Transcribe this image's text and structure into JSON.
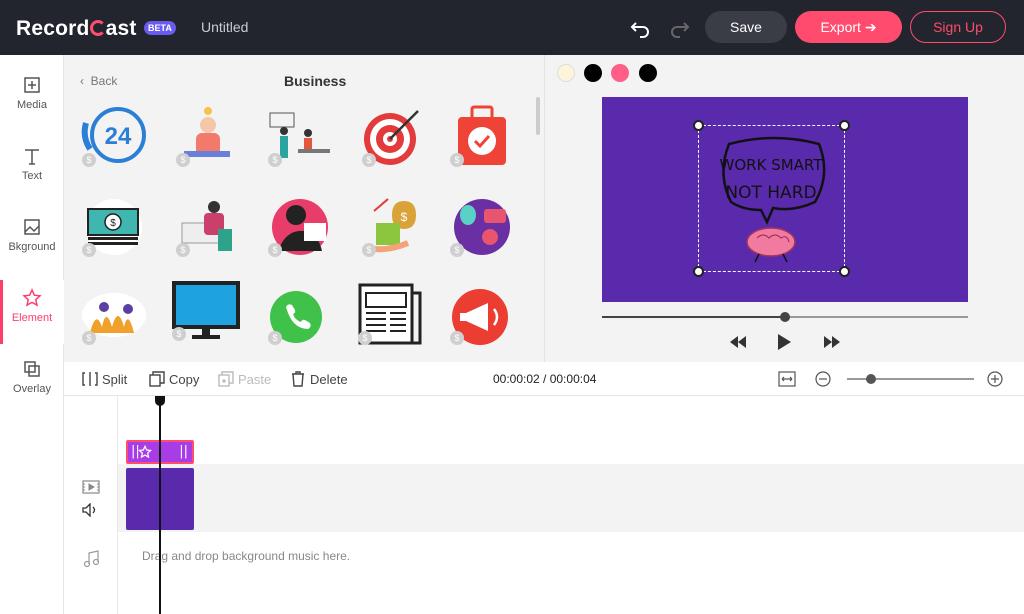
{
  "header": {
    "logo": "Recordcast",
    "beta": "BETA",
    "title": "Untitled",
    "save": "Save",
    "export": "Export",
    "signup": "Sign Up",
    "accent": "#ff4b6e"
  },
  "sidebar": {
    "items": [
      {
        "label": "Media",
        "icon": "media-icon"
      },
      {
        "label": "Text",
        "icon": "text-icon"
      },
      {
        "label": "Bkground",
        "icon": "background-icon"
      },
      {
        "label": "Element",
        "icon": "star-icon",
        "active": true
      },
      {
        "label": "Overlay",
        "icon": "overlay-icon"
      }
    ]
  },
  "panel": {
    "back": "Back",
    "title": "Business",
    "thumbs": [
      {
        "name": "24-hour-support"
      },
      {
        "name": "idea-person"
      },
      {
        "name": "office-meeting"
      },
      {
        "name": "target-arrow"
      },
      {
        "name": "briefcase-check"
      },
      {
        "name": "cash-money"
      },
      {
        "name": "desk-work"
      },
      {
        "name": "business-person"
      },
      {
        "name": "money-growth"
      },
      {
        "name": "alien-idea"
      },
      {
        "name": "team-plants"
      },
      {
        "name": "computer-monitor"
      },
      {
        "name": "phone-call"
      },
      {
        "name": "newspaper"
      },
      {
        "name": "megaphone"
      }
    ]
  },
  "preview": {
    "swatches": [
      "#fcf5dc",
      "#000000",
      "#ff5e88",
      "#000000"
    ],
    "canvas_color": "#5a2aad",
    "sticker_text": "WORK SMART NOT HARD",
    "seek_progress": 0.5
  },
  "toolbar": {
    "split": "Split",
    "copy": "Copy",
    "paste": "Paste",
    "delete": "Delete",
    "time": "00:00:02 / 00:00:04",
    "zoom_level": 0.15
  },
  "timeline": {
    "music_placeholder": "Drag and drop background music here."
  }
}
